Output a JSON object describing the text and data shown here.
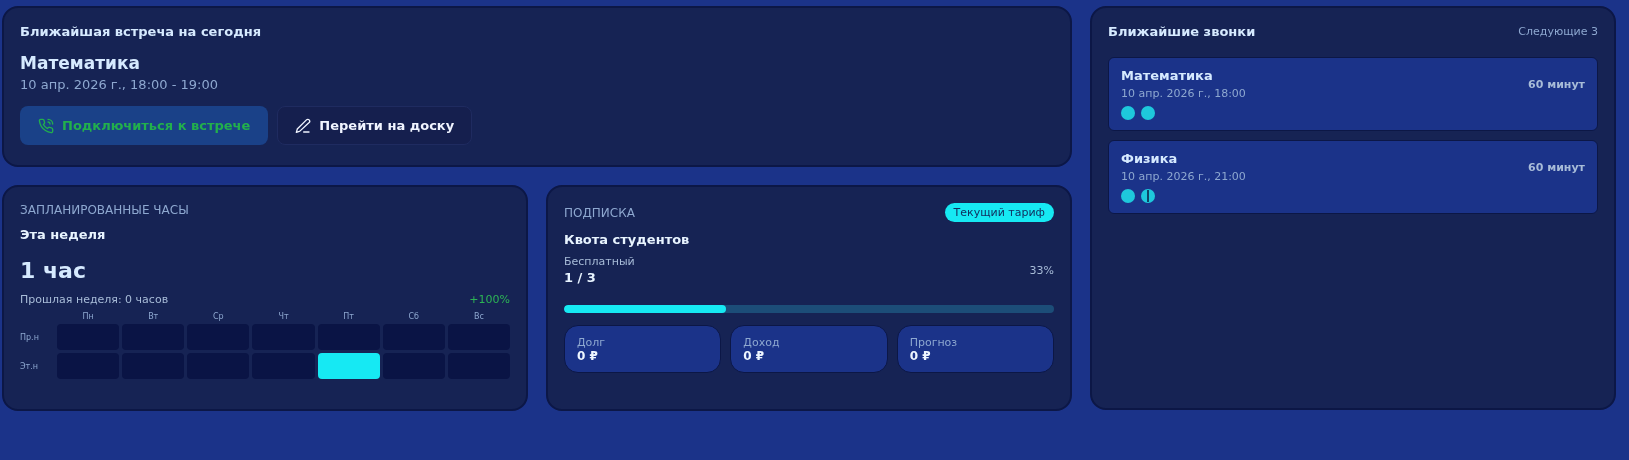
{
  "meeting": {
    "heading": "Ближайшая встреча на сегодня",
    "subject": "Математика",
    "time": "10 апр. 2026 г., 18:00 - 19:00",
    "buttons": [
      {
        "label": "Подключиться к встрече",
        "kind": "join"
      },
      {
        "label": "Перейти на доску",
        "kind": "board"
      }
    ]
  },
  "hours": {
    "caption": "ЗАПЛАНИРОВАННЫЕ ЧАСЫ",
    "period": "Эта неделя",
    "total": "1 час",
    "previous": "Прошлая неделя: 0 часов",
    "change": "+100%",
    "days": [
      "Пн",
      "Вт",
      "Ср",
      "Чт",
      "Пт",
      "Сб",
      "Вс"
    ],
    "rows": [
      {
        "label": "Пр.н",
        "cells": [
          false,
          false,
          false,
          false,
          false,
          false,
          false
        ]
      },
      {
        "label": "Эт.н",
        "cells": [
          false,
          false,
          false,
          false,
          true,
          false,
          false
        ]
      }
    ]
  },
  "subscription": {
    "caption": "ПОДПИСКА",
    "badge": "Текущий тариф",
    "title": "Квота студентов",
    "plan": "Бесплатный",
    "usage": "1 / 3",
    "percent": "33%",
    "level": 0.33,
    "stats": [
      {
        "label": "Долг",
        "value": "0 ₽"
      },
      {
        "label": "Доход",
        "value": "0 ₽"
      },
      {
        "label": "Прогноз",
        "value": "0 ₽"
      }
    ]
  },
  "calls": {
    "heading": "Ближайшие звонки",
    "note": "Следующие 3",
    "items": [
      {
        "subject": "Математика",
        "time": "10 апр. 2026 г., 18:00",
        "duration": "60 минут",
        "participants": [
          {
            "kind": "full"
          },
          {
            "kind": "full"
          }
        ]
      },
      {
        "subject": "Физика",
        "time": "10 апр. 2026 г., 21:00",
        "duration": "60 минут",
        "participants": [
          {
            "kind": "full"
          },
          {
            "kind": "divided"
          }
        ]
      }
    ]
  }
}
